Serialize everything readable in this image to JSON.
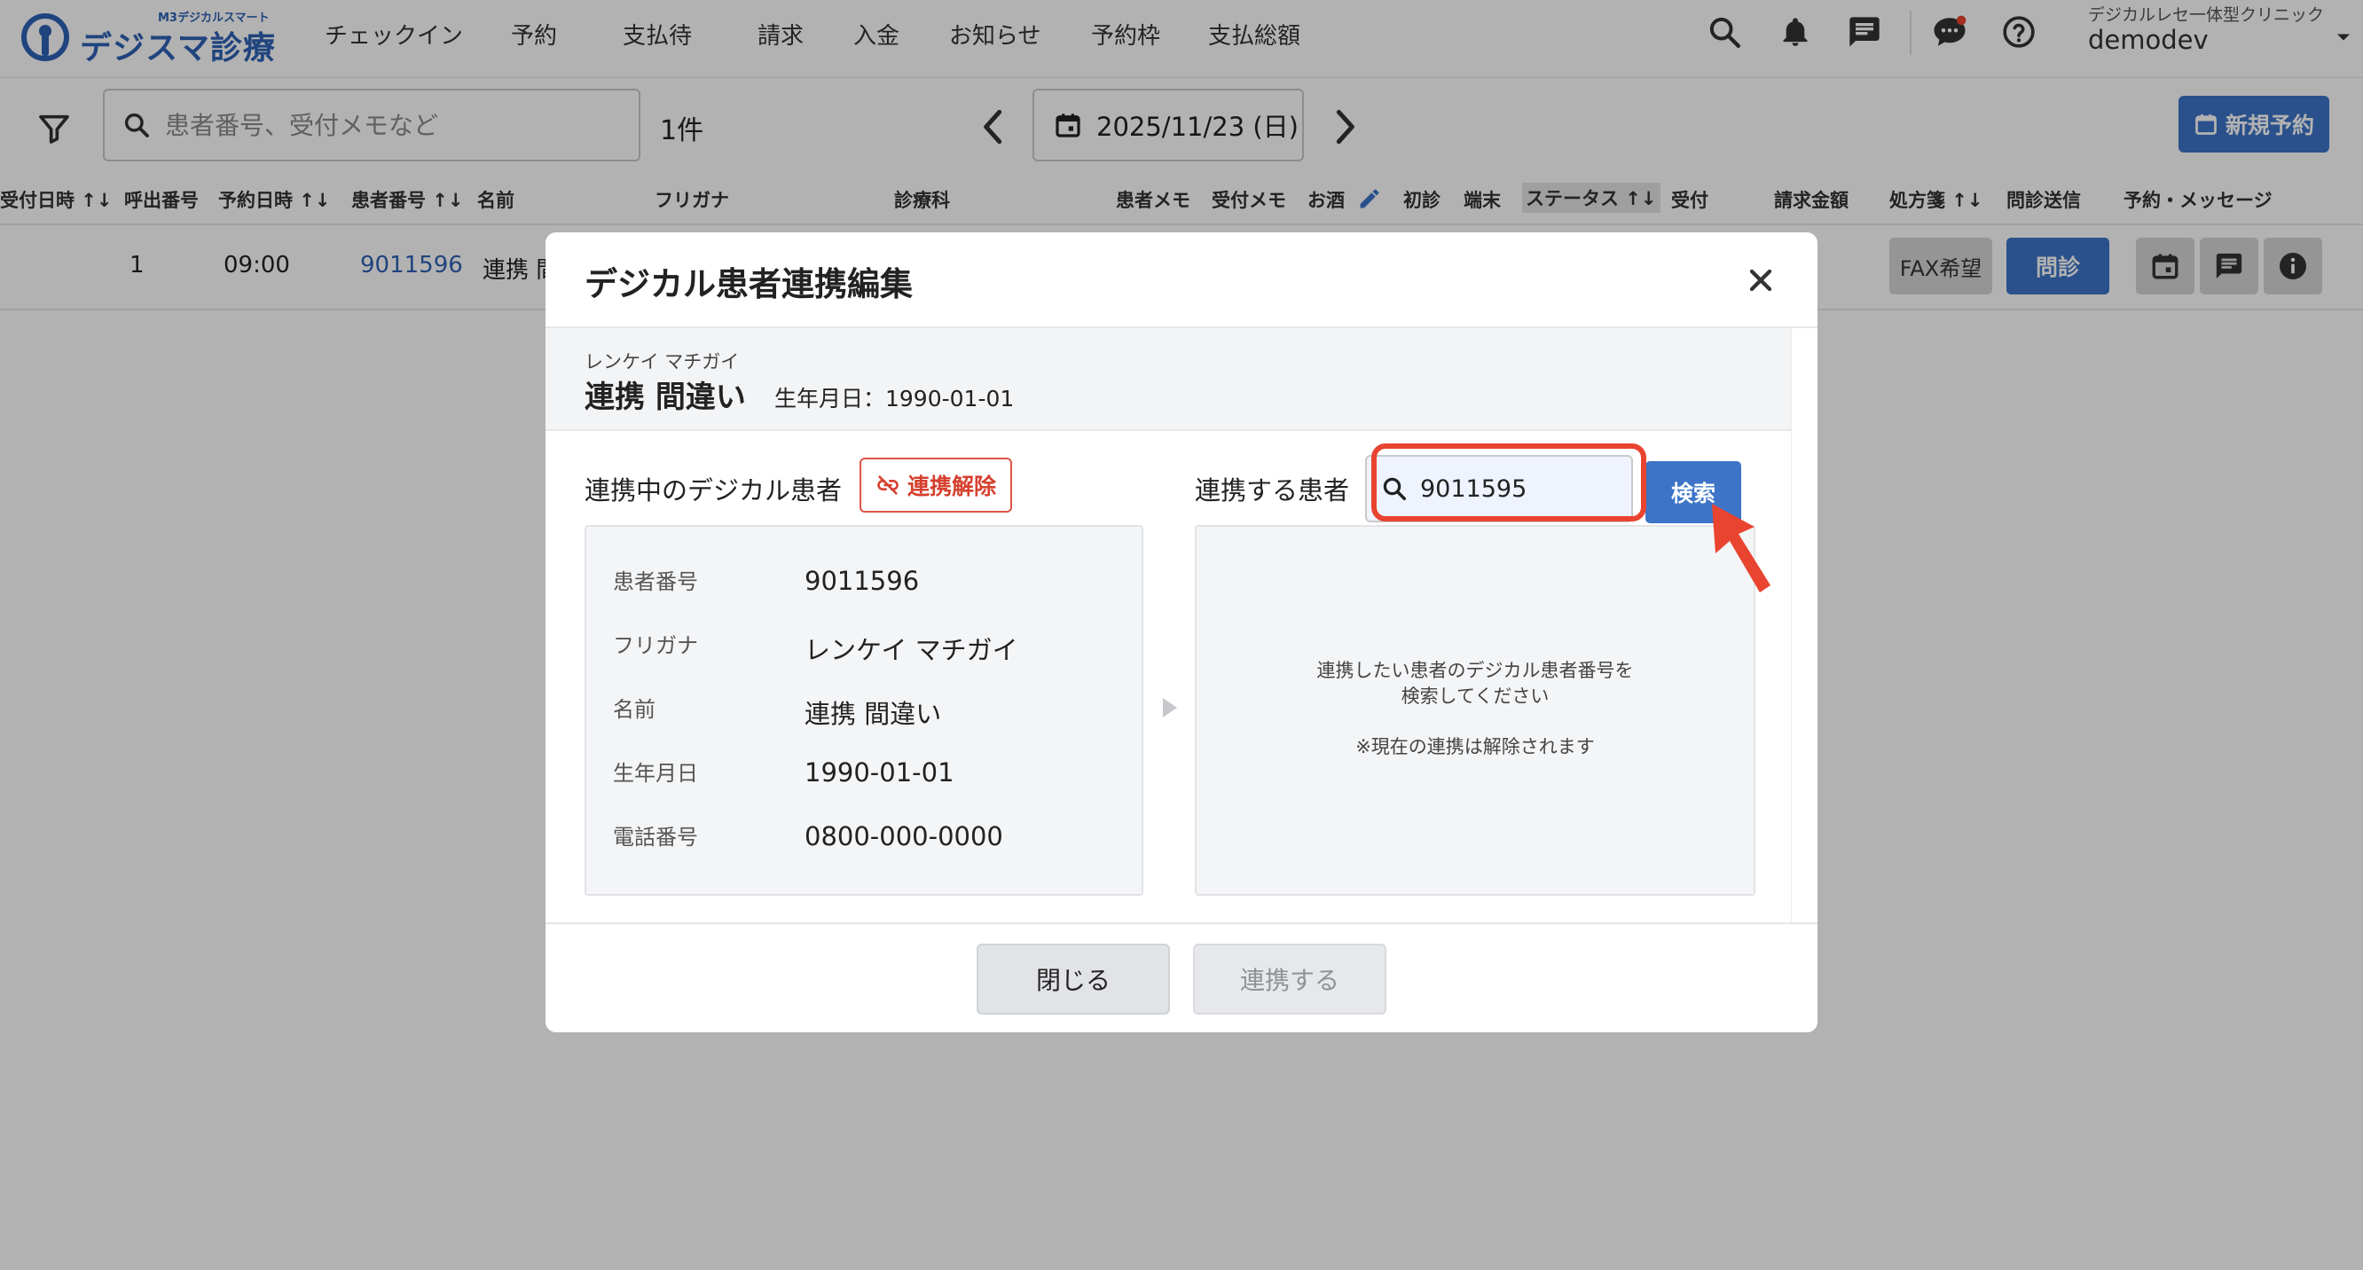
{
  "header": {
    "logo_sub": "M3デジカルスマート",
    "logo_main": "デジスマ診療",
    "nav": [
      "チェックイン",
      "予約",
      "支払待",
      "請求",
      "入金",
      "お知らせ",
      "予約枠",
      "支払総額"
    ],
    "clinic_sub": "デジカルレセ一体型クリニック",
    "clinic_name": "demodev"
  },
  "toolbar": {
    "search_placeholder": "患者番号、受付メモなど",
    "count": "1件",
    "date": "2025/11/23 (日)",
    "new_button": "新規予約"
  },
  "table": {
    "headers": [
      "受付日時 ↑↓",
      "呼出番号",
      "予約日時 ↑↓",
      "患者番号 ↑↓",
      "名前",
      "フリガナ",
      "診療科",
      "患者メモ",
      "受付メモ",
      "お酒",
      "初診",
      "端末",
      "ステータス ↑↓",
      "受付",
      "請求金額",
      "処方箋 ↑↓",
      "問診送信",
      "予約・メッセージ"
    ],
    "row": {
      "call_no": "1",
      "time": "09:00",
      "patient_no": "9011596",
      "name": "連携 間",
      "fax": "FAX希望",
      "monshin": "問診"
    }
  },
  "modal": {
    "title": "デジカル患者連携編集",
    "patient_kana": "レンケイ マチガイ",
    "patient_name": "連携 間違い",
    "patient_dob": "生年月日：1990-01-01",
    "left_label": "連携中のデジカル患者",
    "unlink_label": "連携解除",
    "info": [
      {
        "label": "患者番号",
        "value": "9011596"
      },
      {
        "label": "フリガナ",
        "value": "レンケイ マチガイ"
      },
      {
        "label": "名前",
        "value": "連携 間違い"
      },
      {
        "label": "生年月日",
        "value": "1990-01-01"
      },
      {
        "label": "電話番号",
        "value": "0800-000-0000"
      }
    ],
    "right_label": "連携する患者",
    "search_value": "9011595",
    "search_button": "検索",
    "result_msg_1": "連携したい患者のデジカル患者番号を",
    "result_msg_2": "検索してください",
    "result_note": "※現在の連携は解除されます",
    "close_button": "閉じる",
    "link_button": "連携する"
  },
  "colors": {
    "brand": "#2f62b5",
    "primary_button": "#3d74c8",
    "danger": "#d6402f",
    "highlight": "#e84430"
  }
}
